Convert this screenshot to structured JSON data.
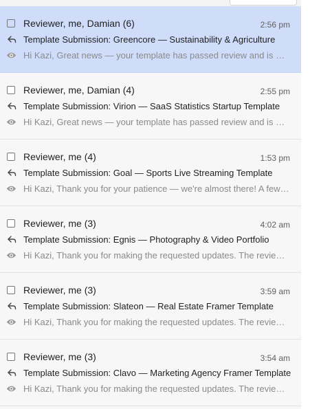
{
  "threads": [
    {
      "senders": "Reviewer, me, Damian (6)",
      "time": "2:56 pm",
      "subject": "Template Submission: Greencore — Sustainability & Agriculture",
      "snippet": "Hi Kazi, Great news — your template has passed review and is now live",
      "selected": true
    },
    {
      "senders": "Reviewer, me, Damian (4)",
      "time": "2:55 pm",
      "subject": "Template Submission: Virion — SaaS Statistics Startup Template",
      "snippet": "Hi Kazi, Great news — your template has passed review and is now live",
      "selected": false
    },
    {
      "senders": "Reviewer, me (4)",
      "time": "1:53 pm",
      "subject": "Template Submission: Goal — Sports Live Streaming Template",
      "snippet": "Hi Kazi, Thank you for your patience — we're almost there! A few final notes",
      "selected": false
    },
    {
      "senders": "Reviewer, me (3)",
      "time": "4:02 am",
      "subject": "Template Submission: Egnis — Photography & Video Portfolio",
      "snippet": "Hi Kazi, Thank you for making the requested updates. The review is complete",
      "selected": false
    },
    {
      "senders": "Reviewer, me (3)",
      "time": "3:59 am",
      "subject": "Template Submission: Slateon — Real Estate Framer Template",
      "snippet": "Hi Kazi, Thank you for making the requested updates. The review is complete",
      "selected": false
    },
    {
      "senders": "Reviewer, me (3)",
      "time": "3:54 am",
      "subject": "Template Submission: Clavo — Marketing Agency Framer Template",
      "snippet": "Hi Kazi, Thank you for making the requested updates. The review is complete",
      "selected": false
    }
  ],
  "icons": {
    "reply": "reply-arrow-icon",
    "preview": "eye-icon"
  },
  "colors": {
    "selected_background": "#cfddfb",
    "list_background": "#f7f7f7",
    "snippet_text": "#8a8a8a"
  }
}
